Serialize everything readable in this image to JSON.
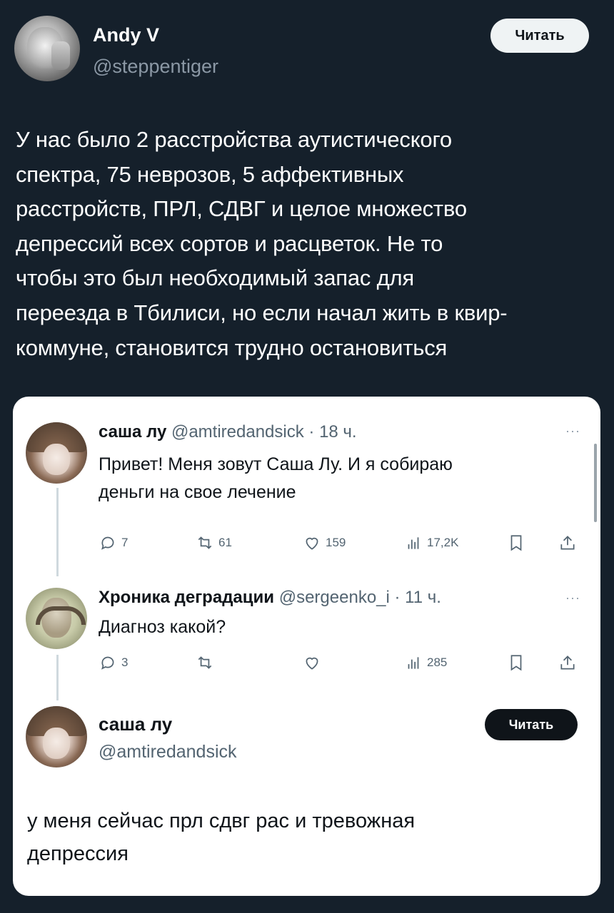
{
  "tweet": {
    "author_name": "Andy V",
    "author_handle": "@steppentiger",
    "follow_label": "Читать",
    "text_lines": [
      "У нас было 2 расстройства аутистического",
      "спектра, 75 неврозов, 5 аффективных",
      "расстройств, ПРЛ, СДВГ и целое множество",
      "депрессий всех сортов и расцветок. Не то",
      "чтобы это был необходимый запас для",
      "переезда в Тбилиси, но если начал жить в квир-",
      "коммуне, становится трудно остановиться"
    ]
  },
  "embedded": {
    "post1": {
      "name": "саша лу",
      "handle": "@amtiredandsick",
      "time": "· 18 ч.",
      "text_lines": [
        "Привет! Меня зовут Саша Лу. И я собираю",
        "деньги на свое лечение"
      ],
      "replies": "7",
      "reposts": "61",
      "likes": "159",
      "views": "17,2K"
    },
    "post2": {
      "name": "Хроника деградации",
      "handle": "@sergeenko_i",
      "time": "· 11 ч.",
      "text": "Диагноз какой?",
      "replies": "3",
      "reposts": "",
      "likes": "",
      "views": "285"
    },
    "post3": {
      "name": "саша лу",
      "handle": "@amtiredandsick",
      "follow_label": "Читать",
      "text_lines": [
        "у меня сейчас прл сдвг рас и тревожная",
        "депрессия"
      ]
    },
    "more_label": "···"
  }
}
